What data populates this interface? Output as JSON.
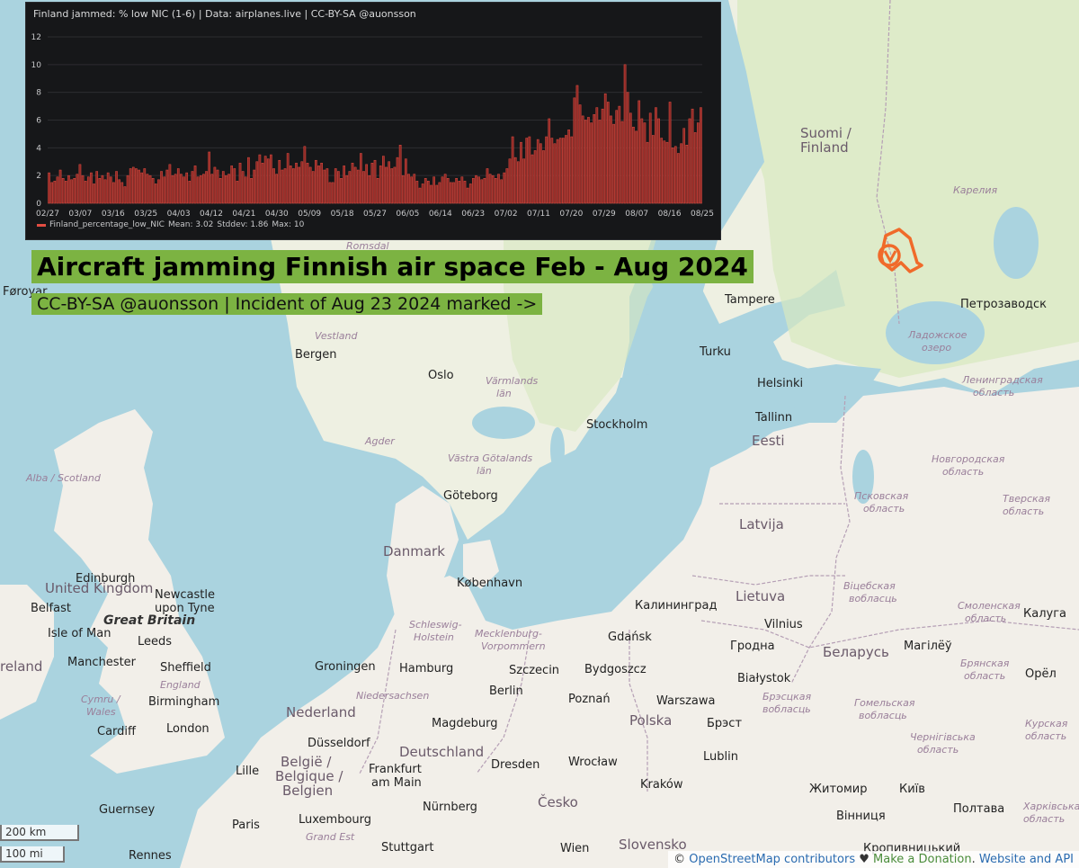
{
  "chart": {
    "title": "Finland jammed: % low NIC (1-6) | Data: airplanes.live | CC-BY-SA @auonsson",
    "legend": {
      "series": "Finland_percentage_low_NIC",
      "mean": "Mean: 3.02",
      "stddev": "Stddev: 1.86",
      "max": "Max: 10"
    }
  },
  "chart_data": {
    "type": "bar",
    "ylim": [
      0,
      12
    ],
    "yticks": [
      "0",
      "2",
      "4",
      "6",
      "8",
      "10",
      "12"
    ],
    "xticks": [
      "02/27",
      "03/07",
      "03/16",
      "03/25",
      "04/03",
      "04/12",
      "04/21",
      "04/30",
      "05/09",
      "05/18",
      "05/27",
      "06/05",
      "06/14",
      "06/23",
      "07/02",
      "07/11",
      "07/20",
      "07/29",
      "08/07",
      "08/16",
      "08/25"
    ],
    "series": [
      {
        "name": "Finland_percentage_low_NIC",
        "color": "#e24d42",
        "values": [
          2.2,
          1.5,
          1.6,
          1.9,
          2.4,
          1.8,
          1.6,
          2.0,
          1.7,
          1.8,
          2.1,
          2.8,
          2.0,
          1.6,
          1.9,
          2.2,
          1.4,
          2.3,
          1.8,
          2.0,
          1.7,
          2.2,
          1.9,
          1.5,
          2.3,
          1.7,
          1.5,
          1.2,
          2.0,
          2.5,
          2.6,
          2.5,
          2.4,
          2.2,
          2.5,
          2.1,
          2.0,
          1.8,
          1.4,
          1.7,
          2.3,
          1.9,
          2.4,
          2.8,
          2.0,
          2.1,
          2.5,
          2.1,
          1.9,
          2.2,
          1.6,
          2.3,
          2.7,
          1.9,
          2.0,
          2.1,
          2.3,
          3.7,
          2.1,
          2.6,
          2.4,
          1.8,
          2.3,
          2.0,
          2.1,
          2.7,
          2.5,
          1.6,
          2.9,
          2.3,
          1.9,
          3.3,
          1.8,
          2.4,
          3.0,
          3.5,
          2.9,
          3.4,
          3.2,
          3.5,
          2.5,
          2.1,
          3.1,
          2.4,
          2.5,
          3.6,
          2.7,
          2.5,
          2.9,
          2.6,
          3.0,
          4.1,
          2.9,
          2.6,
          2.3,
          3.1,
          2.7,
          2.9,
          2.4,
          2.5,
          1.5,
          1.5,
          2.5,
          2.3,
          1.8,
          2.7,
          2.0,
          2.3,
          2.9,
          2.6,
          2.4,
          3.6,
          2.3,
          2.8,
          2.0,
          2.9,
          3.1,
          1.8,
          2.7,
          3.4,
          2.6,
          3.0,
          2.5,
          2.6,
          3.3,
          4.2,
          2.0,
          3.2,
          2.1,
          1.9,
          2.1,
          1.6,
          1.1,
          1.4,
          1.8,
          1.6,
          1.3,
          1.9,
          1.3,
          1.5,
          1.9,
          2.1,
          1.8,
          1.5,
          1.5,
          1.8,
          1.6,
          1.9,
          1.6,
          1.1,
          1.4,
          1.8,
          2.0,
          1.9,
          1.7,
          1.8,
          2.5,
          2.1,
          2.0,
          1.8,
          2.1,
          1.7,
          2.2,
          2.5,
          3.2,
          4.8,
          3.3,
          3.0,
          4.4,
          3.2,
          4.7,
          4.8,
          3.5,
          3.8,
          4.6,
          4.3,
          3.8,
          4.8,
          6.1,
          4.7,
          4.3,
          4.6,
          4.7,
          4.7,
          4.9,
          5.3,
          4.8,
          7.6,
          8.5,
          7.1,
          6.3,
          6.0,
          6.2,
          5.8,
          6.4,
          6.9,
          6.0,
          6.8,
          7.9,
          7.3,
          6.3,
          5.7,
          6.7,
          7.0,
          5.9,
          10.0,
          8.0,
          6.5,
          5.5,
          5.2,
          7.4,
          6.1,
          5.8,
          4.4,
          6.5,
          4.9,
          6.9,
          6.1,
          4.7,
          4.5,
          4.4,
          7.3,
          4.0,
          4.1,
          3.6,
          4.3,
          5.4,
          4.2,
          6.1,
          6.8,
          5.1,
          5.8,
          6.9
        ]
      }
    ]
  },
  "banner": {
    "title": "Aircraft jamming Finnish air space Feb - Aug 2024",
    "subtitle": "CC-BY-SA @auonsson | Incident of Aug 23 2024 marked ->"
  },
  "map": {
    "labels": {
      "suomi": "Suomi /",
      "finland": "Finland",
      "karelia": "Карелия",
      "tampere": "Tampere",
      "petrozavodsk": "Петрозаводск",
      "turku": "Turku",
      "ladoga1": "Ладожское",
      "ladoga2": "озеро",
      "helsinki": "Helsinki",
      "leningrad1": "Ленинградская",
      "leningrad2": "область",
      "tallinn": "Tallinn",
      "eesti": "Eesti",
      "novgorod1": "Новгородская",
      "novgorod2": "область",
      "pskov1": "Псковская",
      "pskov2": "область",
      "tver1": "Тверская",
      "tver2": "область",
      "latvija": "Latvija",
      "vitebsk1": "Віцебская",
      "vitebsk2": "вобласць",
      "smolensk1": "Смоленская",
      "smolensk2": "область",
      "lietuva": "Lietuva",
      "kaliningrad": "Калининград",
      "vilnius": "Vilnius",
      "kaluga": "Калуга",
      "hrodna": "Гродна",
      "mahilyow": "Магілёў",
      "belarus": "Беларусь",
      "bryansk1": "Брянская",
      "bryansk2": "область",
      "bialystok": "Białystok",
      "oryol": "Орёл",
      "brest1": "Брэсцкая",
      "brest2": "вобласць",
      "homel1": "Гомельская",
      "homel2": "вобласць",
      "kursk1": "Курская",
      "kursk2": "область",
      "brest": "Брэст",
      "lublin": "Lublin",
      "chernihiv1": "Чернігівська",
      "chernihiv2": "область",
      "kyiv": "Київ",
      "zhytomyr": "Житомир",
      "kharkiv1": "Харківська",
      "kharkiv2": "область",
      "vinnytsia": "Вінниця",
      "poltava": "Полтава",
      "kropyvnytskyi": "Кропивницький",
      "romsdal": "Romsdal",
      "foroyar": "Føroyar",
      "vestland": "Vestland",
      "bergen": "Bergen",
      "oslo": "Oslo",
      "varmlands1": "Värmlands",
      "varmlands2": "län",
      "stockholm": "Stockholm",
      "agder": "Agder",
      "vastra1": "Västra Götalands",
      "vastra2": "län",
      "goteborg": "Göteborg",
      "alba": "Alba / Scotland",
      "danmark": "Danmark",
      "kobenhavn": "København",
      "edinburgh": "Edinburgh",
      "uk": "United Kingdom",
      "newcastle1": "Newcastle",
      "newcastle2": "upon Tyne",
      "belfast": "Belfast",
      "greatbritain": "Great Britain",
      "isleofman": "Isle of Man",
      "leeds": "Leeds",
      "ireland": "reland",
      "manchester": "Manchester",
      "sheffield": "Sheffield",
      "england": "England",
      "cymru1": "Cymru /",
      "cymru2": "Wales",
      "birmingham": "Birmingham",
      "cardiff": "Cardiff",
      "london": "London",
      "guernsey": "Guernsey",
      "schleswig1": "Schleswig-",
      "schleswig2": "Holstein",
      "mecklenburg1": "Mecklenburg-",
      "mecklenburg2": "Vorpommern",
      "gdansk": "Gdańsk",
      "groningen": "Groningen",
      "hamburg": "Hamburg",
      "szczecin": "Szczecin",
      "bydgoszcz": "Bydgoszcz",
      "niedersachsen": "Niedersachsen",
      "berlin": "Berlin",
      "poznan": "Poznań",
      "warszawa": "Warszawa",
      "nederland": "Nederland",
      "polska": "Polska",
      "magdeburg": "Magdeburg",
      "dusseldorf": "Düsseldorf",
      "deutschland": "Deutschland",
      "belgie1": "België /",
      "belgie2": "Belgique /",
      "belgie3": "Belgien",
      "lille": "Lille",
      "dresden": "Dresden",
      "wroclaw": "Wrocław",
      "frankfurt1": "Frankfurt",
      "frankfurt2": "am Main",
      "krakow": "Kraków",
      "luxembourg": "Luxembourg",
      "cesko": "Česko",
      "paris": "Paris",
      "nurnberg": "Nürnberg",
      "grandest": "Grand Est",
      "stuttgart": "Stuttgart",
      "wien": "Wien",
      "slovensko": "Slovensko",
      "rennes": "Rennes",
      "xxx_ulster": ""
    }
  },
  "scale": {
    "km": "200 km",
    "mi": "100 mi"
  },
  "attribution": {
    "copy": "©",
    "osm": "OpenStreetMap contributors",
    "heart": "♥",
    "donate": "Make a Donation",
    "dot": ".",
    "website": "Website and API"
  },
  "colors": {
    "sea": "#aad3df",
    "land": "#f2efe9",
    "forest": "#c8dfa6",
    "bar": "#e24d42",
    "banner": "#7cb342",
    "track": "#f06a2a"
  }
}
